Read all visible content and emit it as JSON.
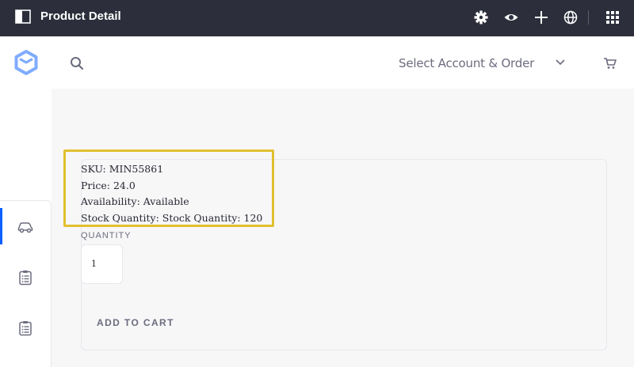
{
  "topbar": {
    "title": "Product Detail",
    "icons": [
      "panel-toggle-icon",
      "gear-icon",
      "eye-icon",
      "plus-icon",
      "globe-icon",
      "apps-grid-icon"
    ]
  },
  "header": {
    "account_selector": "Select Account & Order",
    "icons": [
      "logo-icon",
      "search-icon",
      "chevron-down-icon",
      "cart-icon"
    ]
  },
  "sidebar": {
    "icons": [
      "car-icon",
      "clipboard-list-icon",
      "clipboard-list-icon"
    ]
  },
  "product": {
    "sku": "SKU: MIN55861",
    "price": "Price: 24.0",
    "availability": "Availability: Available",
    "stock": "Stock Quantity: Stock Quantity: 120"
  },
  "quantity": {
    "label": "QUANTITY",
    "value": "1"
  },
  "actions": {
    "add_to_cart": "ADD TO CART"
  },
  "colors": {
    "topbar_bg": "#2c2f3b",
    "accent": "#0b5fff",
    "highlight": "#e1c02e",
    "main_bg": "#f7f7f8"
  }
}
